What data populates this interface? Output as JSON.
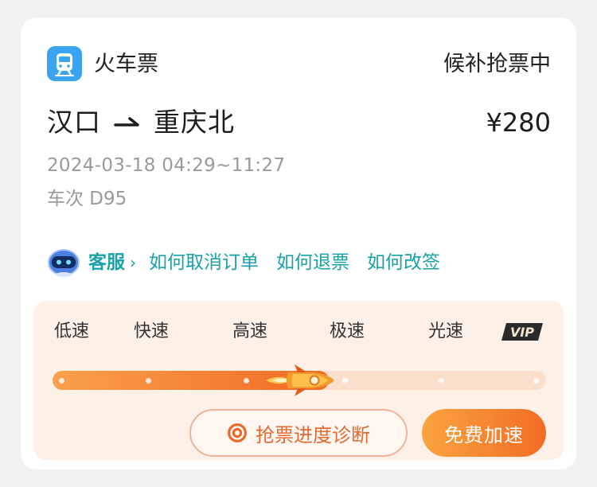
{
  "header": {
    "app_icon": "train-icon",
    "app_name": "火车票",
    "status": "候补抢票中"
  },
  "trip": {
    "from": "汉口",
    "to": "重庆北",
    "price": "¥280",
    "datetime": "2024-03-18 04:29~11:27",
    "train_number": "车次 D95"
  },
  "links": {
    "service_icon": "robot-assistant-icon",
    "service_label": "客服",
    "items": [
      "如何取消订单",
      "如何退票",
      "如何改签"
    ]
  },
  "speed": {
    "levels": [
      "低速",
      "快速",
      "高速",
      "极速",
      "光速"
    ],
    "vip_label": "VIP",
    "current_level": "极速",
    "progress_fraction": 0.56,
    "progress_icon": "rocket-icon",
    "diagnose_label": "抢票进度诊断",
    "diagnose_icon": "ticket-coin-icon",
    "boost_label": "免费加速"
  },
  "colors": {
    "accent_teal": "#1aa2a8",
    "accent_orange": "#f26a24",
    "panel_bg": "#fdf1e7"
  }
}
